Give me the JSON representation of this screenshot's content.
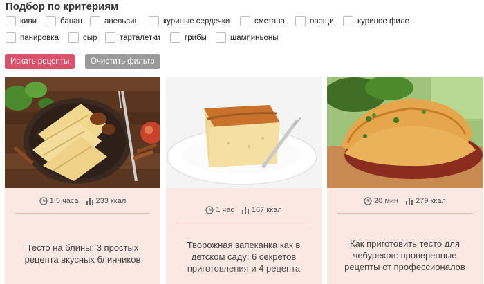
{
  "filter": {
    "title": "Подбор по критериям",
    "row1": [
      "киви",
      "банан",
      "апельсин",
      "куриные сердечки",
      "сметана",
      "овощи",
      "куриное филе"
    ],
    "row2": [
      "панировка",
      "сыр",
      "тарталетки",
      "грибы",
      "шампиньоны"
    ]
  },
  "buttons": {
    "search": "Искать рецепты",
    "clear": "Очистить фильтр"
  },
  "cards": [
    {
      "time": "1.5 часа",
      "kcal": "233 ккал",
      "title": "Тесто на блины: 3 простых рецепта вкусных блинчиков"
    },
    {
      "time": "1 час",
      "kcal": "167 ккал",
      "title": "Творожная запеканка как в детском саду: 6 секретов приготовления и 4 рецепта"
    },
    {
      "time": "20 мин",
      "kcal": "279 ккал",
      "title": "Как приготовить тесто для чебуреков: проверенные рецепты от профессионалов"
    }
  ],
  "icons": {
    "time": "clock-icon",
    "kcal": "calories-chart-icon"
  },
  "colors": {
    "search_button": "#d9516b",
    "clear_button": "#9a9a9a",
    "card_background": "#fce8e3"
  }
}
